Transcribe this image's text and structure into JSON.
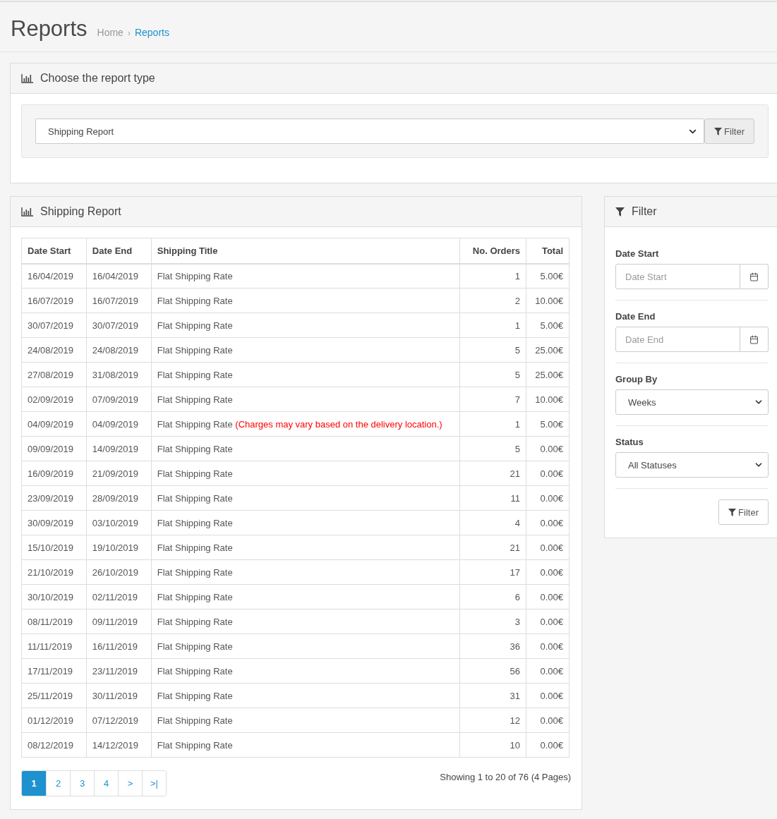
{
  "page": {
    "title": "Reports",
    "separator": "›",
    "breadcrumb": [
      {
        "label": "Home",
        "current": false
      },
      {
        "label": "Reports",
        "current": true
      }
    ]
  },
  "report_type_panel": {
    "title": "Choose the report type",
    "select_value": "Shipping Report",
    "button": "Filter"
  },
  "report_panel": {
    "title": "Shipping Report",
    "columns": [
      "Date Start",
      "Date End",
      "Shipping Title",
      "No. Orders",
      "Total"
    ],
    "rows": [
      {
        "date_start": "16/04/2019",
        "date_end": "16/04/2019",
        "shipping_title": "Flat Shipping Rate",
        "orders": "1",
        "total": "5.00€"
      },
      {
        "date_start": "16/07/2019",
        "date_end": "16/07/2019",
        "shipping_title": "Flat Shipping Rate",
        "orders": "2",
        "total": "10.00€"
      },
      {
        "date_start": "30/07/2019",
        "date_end": "30/07/2019",
        "shipping_title": "Flat Shipping Rate",
        "orders": "1",
        "total": "5.00€"
      },
      {
        "date_start": "24/08/2019",
        "date_end": "24/08/2019",
        "shipping_title": "Flat Shipping Rate",
        "orders": "5",
        "total": "25.00€"
      },
      {
        "date_start": "27/08/2019",
        "date_end": "31/08/2019",
        "shipping_title": "Flat Shipping Rate",
        "orders": "5",
        "total": "25.00€"
      },
      {
        "date_start": "02/09/2019",
        "date_end": "07/09/2019",
        "shipping_title": "Flat Shipping Rate",
        "orders": "7",
        "total": "10.00€"
      },
      {
        "date_start": "04/09/2019",
        "date_end": "04/09/2019",
        "shipping_title": "Flat Shipping Rate",
        "note": "(Charges may vary based on the delivery location.)",
        "orders": "1",
        "total": "5.00€"
      },
      {
        "date_start": "09/09/2019",
        "date_end": "14/09/2019",
        "shipping_title": "Flat Shipping Rate",
        "orders": "5",
        "total": "0.00€"
      },
      {
        "date_start": "16/09/2019",
        "date_end": "21/09/2019",
        "shipping_title": "Flat Shipping Rate",
        "orders": "21",
        "total": "0.00€"
      },
      {
        "date_start": "23/09/2019",
        "date_end": "28/09/2019",
        "shipping_title": "Flat Shipping Rate",
        "orders": "11",
        "total": "0.00€"
      },
      {
        "date_start": "30/09/2019",
        "date_end": "03/10/2019",
        "shipping_title": "Flat Shipping Rate",
        "orders": "4",
        "total": "0.00€"
      },
      {
        "date_start": "15/10/2019",
        "date_end": "19/10/2019",
        "shipping_title": "Flat Shipping Rate",
        "orders": "21",
        "total": "0.00€"
      },
      {
        "date_start": "21/10/2019",
        "date_end": "26/10/2019",
        "shipping_title": "Flat Shipping Rate",
        "orders": "17",
        "total": "0.00€"
      },
      {
        "date_start": "30/10/2019",
        "date_end": "02/11/2019",
        "shipping_title": "Flat Shipping Rate",
        "orders": "6",
        "total": "0.00€"
      },
      {
        "date_start": "08/11/2019",
        "date_end": "09/11/2019",
        "shipping_title": "Flat Shipping Rate",
        "orders": "3",
        "total": "0.00€"
      },
      {
        "date_start": "11/11/2019",
        "date_end": "16/11/2019",
        "shipping_title": "Flat Shipping Rate",
        "orders": "36",
        "total": "0.00€"
      },
      {
        "date_start": "17/11/2019",
        "date_end": "23/11/2019",
        "shipping_title": "Flat Shipping Rate",
        "orders": "56",
        "total": "0.00€"
      },
      {
        "date_start": "25/11/2019",
        "date_end": "30/11/2019",
        "shipping_title": "Flat Shipping Rate",
        "orders": "31",
        "total": "0.00€"
      },
      {
        "date_start": "01/12/2019",
        "date_end": "07/12/2019",
        "shipping_title": "Flat Shipping Rate",
        "orders": "12",
        "total": "0.00€"
      },
      {
        "date_start": "08/12/2019",
        "date_end": "14/12/2019",
        "shipping_title": "Flat Shipping Rate",
        "orders": "10",
        "total": "0.00€"
      }
    ],
    "pagination": [
      {
        "label": "1",
        "selected": true
      },
      {
        "label": "2",
        "selected": false
      },
      {
        "label": "3",
        "selected": false
      },
      {
        "label": "4",
        "selected": false
      },
      {
        "label": ">",
        "selected": false
      },
      {
        "label": ">|",
        "selected": false
      }
    ],
    "summary": "Showing 1 to 20 of 76 (4 Pages)"
  },
  "filter_panel": {
    "title": "Filter",
    "fields": [
      {
        "kind": "date",
        "label": "Date Start",
        "placeholder": "Date Start"
      },
      {
        "kind": "date",
        "label": "Date End",
        "placeholder": "Date End"
      },
      {
        "kind": "select",
        "label": "Group By",
        "value": "Weeks"
      },
      {
        "kind": "select",
        "label": "Status",
        "value": "All Statuses"
      }
    ],
    "button": "Filter"
  }
}
